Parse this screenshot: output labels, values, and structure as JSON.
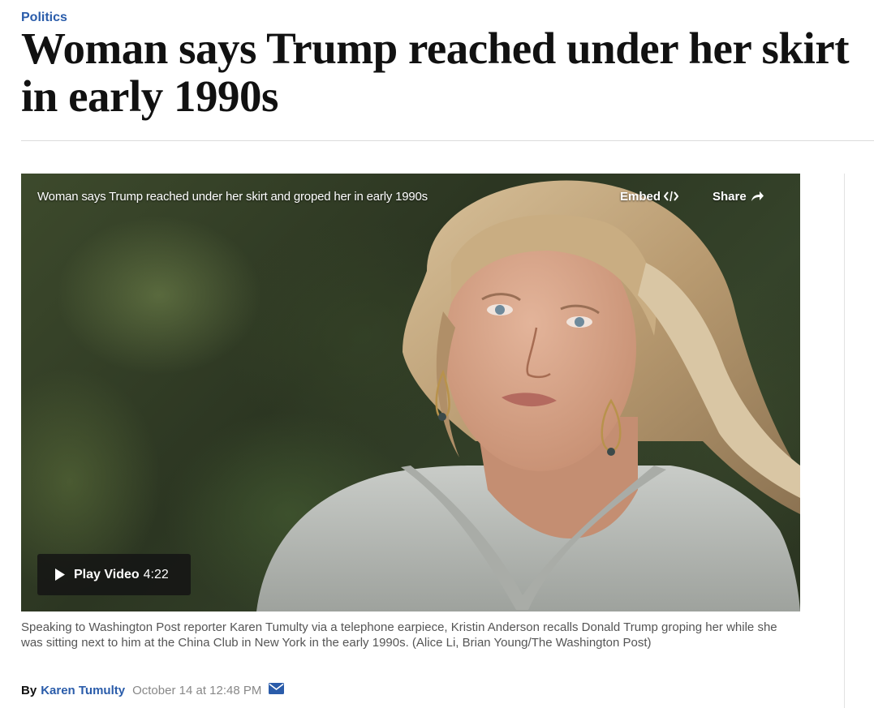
{
  "section": "Politics",
  "headline": "Woman says Trump reached under her skirt in early 1990s",
  "video": {
    "title": "Woman says Trump reached under her skirt and groped her in early 1990s",
    "embed_label": "Embed",
    "share_label": "Share",
    "play_label": "Play Video",
    "duration": "4:22"
  },
  "caption": "Speaking to Washington Post reporter Karen Tumulty via a telephone earpiece, Kristin Anderson recalls Donald Trump groping her while she was sitting next to him at the China Club in New York in the early 1990s. (Alice Li, Brian Young/The Washington Post)",
  "byline": {
    "by": "By",
    "author": "Karen Tumulty",
    "date": "October 14 at 12:48 PM"
  },
  "colors": {
    "accent": "#2a5caa",
    "headline": "#111111",
    "caption": "#555555"
  },
  "icons": [
    "code-icon",
    "share-arrow-icon",
    "play-icon",
    "mail-icon"
  ]
}
